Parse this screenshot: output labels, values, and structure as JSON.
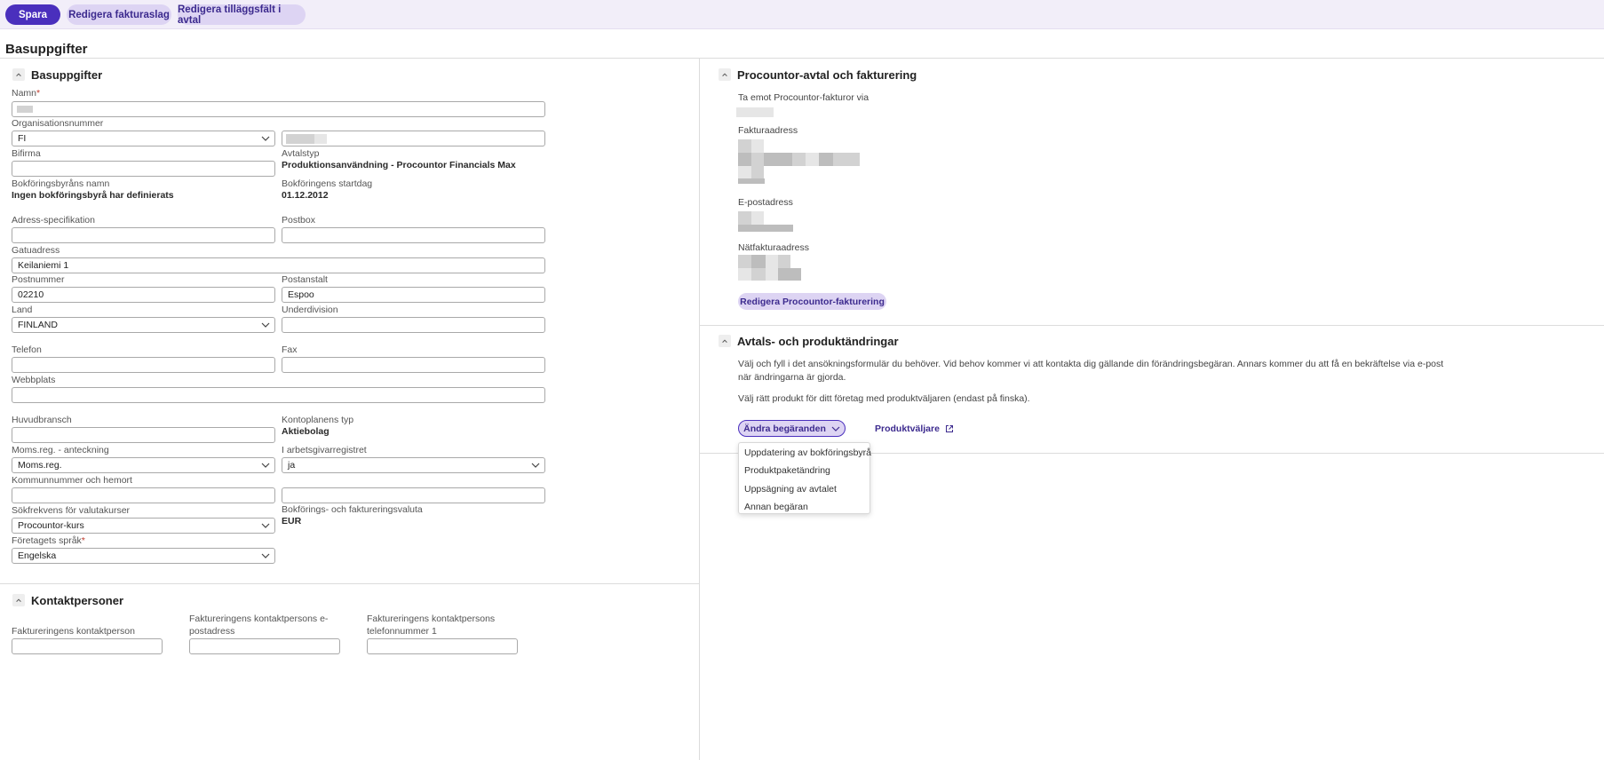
{
  "toolbar": {
    "save": "Spara",
    "edit_invoice_types": "Redigera fakturaslag",
    "edit_extra_fields": "Redigera tilläggsfält i avtal"
  },
  "page_title": "Basuppgifter",
  "basic": {
    "title": "Basuppgifter",
    "name_label": "Namn",
    "org_number_label": "Organisationsnummer",
    "org_country_value": "FI",
    "secondary_name_label": "Bifirma",
    "contract_type_label": "Avtalstyp",
    "contract_type_value": "Produktionsanvändning - Procountor Financials Max",
    "accounting_office_label": "Bokföringsbyråns namn",
    "accounting_office_value": "Ingen bokföringsbyrå har definierats",
    "bookkeeping_start_label": "Bokföringens startdag",
    "bookkeeping_start_value": "01.12.2012",
    "address_spec_label": "Adress-specifikation",
    "pobox_label": "Postbox",
    "street_label": "Gatuadress",
    "street_value": "Keilaniemi 1",
    "postcode_label": "Postnummer",
    "postcode_value": "02210",
    "city_label": "Postanstalt",
    "city_value": "Espoo",
    "country_label": "Land",
    "country_value": "FINLAND",
    "subdivision_label": "Underdivision",
    "phone_label": "Telefon",
    "fax_label": "Fax",
    "website_label": "Webbplats",
    "industry_label": "Huvudbransch",
    "chart_type_label": "Kontoplanens typ",
    "chart_type_value": "Aktiebolag",
    "vat_label": "Moms.reg. - anteckning",
    "vat_value": "Moms.reg.",
    "employer_label": "I arbetsgivarregistret",
    "employer_value": "ja",
    "municipality_label": "Kommunnummer och hemort",
    "fx_label": "Sökfrekvens för valutakurser",
    "fx_value": "Procountor-kurs",
    "currency_label": "Bokförings- och faktureringsvaluta",
    "currency_value": "EUR",
    "language_label": "Företagets språk",
    "language_value": "Engelska"
  },
  "contacts": {
    "title": "Kontaktpersoner",
    "billing_contact_label": "Faktureringens kontaktperson",
    "billing_email_label_1": "Faktureringens kontaktpersons e-",
    "billing_email_label_2": "postadress",
    "billing_phone_label_1": "Faktureringens kontaktpersons",
    "billing_phone_label_2": "telefonnummer 1"
  },
  "procountor": {
    "title": "Procountor-avtal och fakturering",
    "receive_via_label": "Ta emot Procountor-fakturor via",
    "invoice_address_label": "Fakturaadress",
    "email_label": "E-postadress",
    "einvoice_label": "Nätfakturaadress",
    "edit_button": "Redigera Procountor-fakturering"
  },
  "changes": {
    "title": "Avtals- och produktändringar",
    "para1_line1": "Välj och fyll i det ansökningsformulär du behöver. Vid behov kommer vi att kontakta dig gällande din förändringsbegäran. Annars kommer du att få en bekräftelse via e-post",
    "para1_line2": "när ändringarna är gjorda.",
    "para2": "Välj rätt produkt för ditt företag med produktväljaren (endast på finska).",
    "request_button": "Ändra begäranden",
    "product_selector_link": "Produktväljare",
    "menu": [
      "Uppdatering av bokföringsbyrå",
      "Produktpaketändring",
      "Uppsägning av avtalet",
      "Annan begäran"
    ]
  },
  "colors": {
    "primary": "#4a2fbd",
    "secondary": "#ddd4f3",
    "toolbar_bg": "#f2eef9"
  }
}
